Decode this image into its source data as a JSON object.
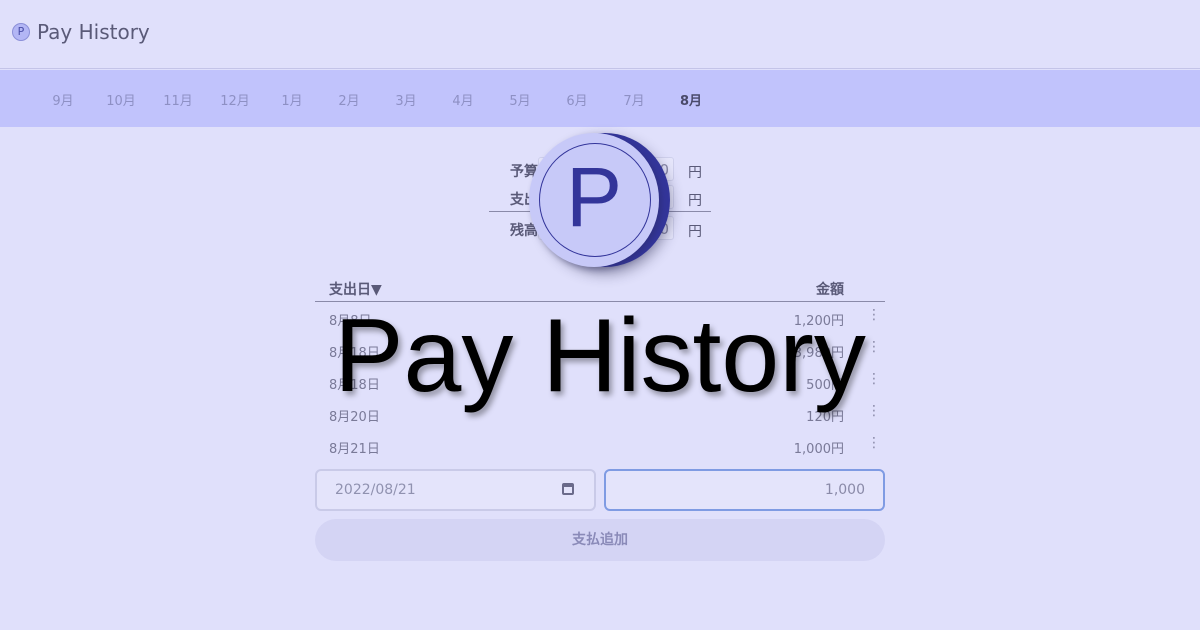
{
  "header": {
    "logo_letter": "P",
    "title": "Pay History"
  },
  "months": [
    "9月",
    "10月",
    "11月",
    "12月",
    "1月",
    "2月",
    "3月",
    "4月",
    "5月",
    "6月",
    "7月",
    "8月"
  ],
  "active_month": "8月",
  "summary": {
    "budget_label": "予算",
    "budget_value": "0",
    "spent_label": "支出",
    "spent_value": "0",
    "balance_label": "残高",
    "balance_value": "0",
    "unit": "円"
  },
  "list": {
    "date_header": "支出日▼",
    "amount_header": "金額",
    "rows": [
      {
        "date": "8月8日",
        "amount": "1,200円"
      },
      {
        "date": "8月18日",
        "amount": "3,980円"
      },
      {
        "date": "8月18日",
        "amount": "500円"
      },
      {
        "date": "8月20日",
        "amount": "120円"
      },
      {
        "date": "8月21日",
        "amount": "1,000円"
      }
    ],
    "row_menu_glyph": "⋮"
  },
  "form": {
    "date_value": "2022/08/21",
    "amount_value": "1,000",
    "add_button": "支払追加"
  },
  "overlay": {
    "logo_letter": "P",
    "title": "Pay History"
  }
}
